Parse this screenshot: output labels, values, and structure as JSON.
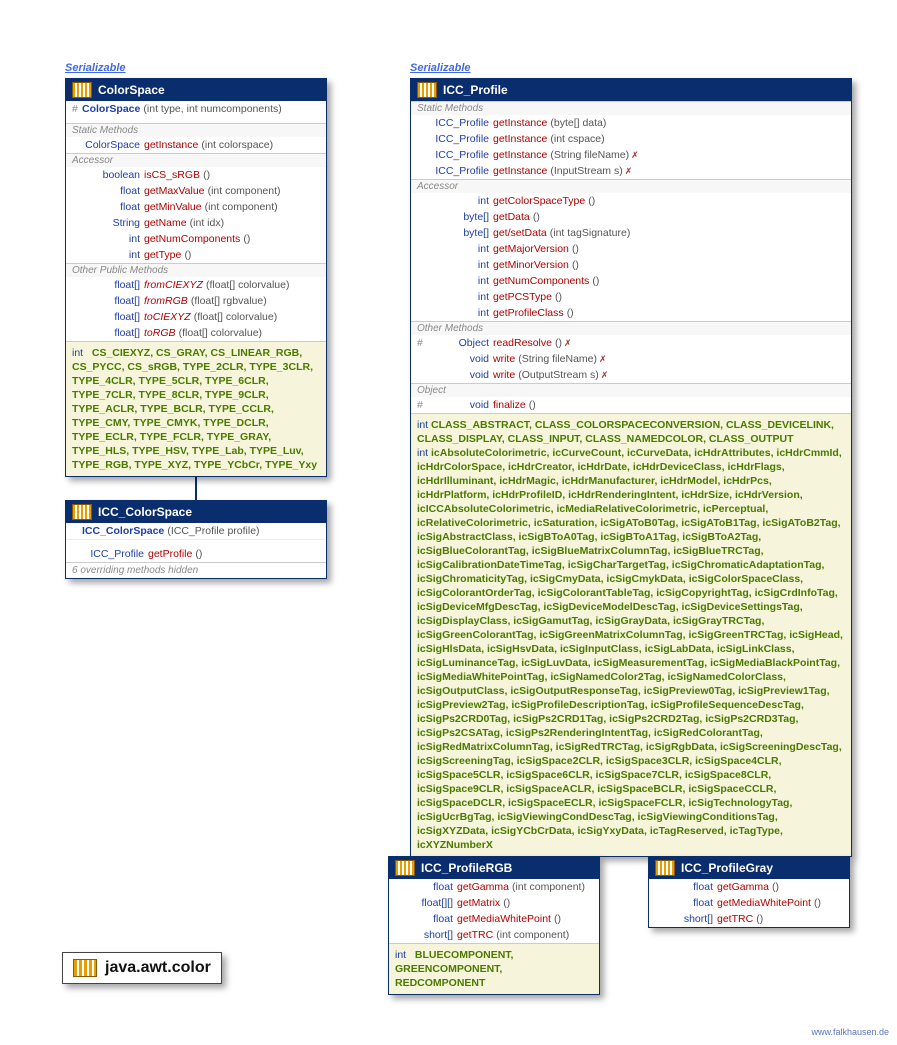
{
  "serializable": "Serializable",
  "package": "java.awt.color",
  "watermark": "www.falkhausen.de",
  "colorSpace": {
    "title": "ColorSpace",
    "ctor": {
      "hash": "#",
      "name": "ColorSpace",
      "params": "(int type, int numcomponents)"
    },
    "sections": {
      "static": "Static Methods",
      "accessor": "Accessor",
      "other": "Other Public Methods"
    },
    "staticMethods": [
      {
        "rt": "ColorSpace",
        "name": "getInstance",
        "params": "(int colorspace)"
      }
    ],
    "accessors": [
      {
        "rt": "boolean",
        "name": "isCS_sRGB",
        "params": "()"
      },
      {
        "rt": "float",
        "name": "getMaxValue",
        "params": "(int component)"
      },
      {
        "rt": "float",
        "name": "getMinValue",
        "params": "(int component)"
      },
      {
        "rt": "String",
        "name": "getName",
        "params": "(int idx)"
      },
      {
        "rt": "int",
        "name": "getNumComponents",
        "params": "()"
      },
      {
        "rt": "int",
        "name": "getType",
        "params": "()"
      }
    ],
    "otherMethods": [
      {
        "rt": "float[]",
        "name": "fromCIEXYZ",
        "params": "(float[] colorvalue)",
        "abs": true
      },
      {
        "rt": "float[]",
        "name": "fromRGB",
        "params": "(float[] rgbvalue)",
        "abs": true
      },
      {
        "rt": "float[]",
        "name": "toCIEXYZ",
        "params": "(float[] colorvalue)",
        "abs": true
      },
      {
        "rt": "float[]",
        "name": "toRGB",
        "params": "(float[] colorvalue)",
        "abs": true
      }
    ],
    "constType": "int",
    "consts": "CS_CIEXYZ, CS_GRAY, CS_LINEAR_RGB, CS_PYCC, CS_sRGB, TYPE_2CLR, TYPE_3CLR, TYPE_4CLR, TYPE_5CLR, TYPE_6CLR, TYPE_7CLR, TYPE_8CLR, TYPE_9CLR, TYPE_ACLR, TYPE_BCLR, TYPE_CCLR, TYPE_CMY, TYPE_CMYK, TYPE_DCLR, TYPE_ECLR, TYPE_FCLR, TYPE_GRAY, TYPE_HLS, TYPE_HSV, TYPE_Lab, TYPE_Luv, TYPE_RGB, TYPE_XYZ, TYPE_YCbCr, TYPE_Yxy"
  },
  "iccColorSpace": {
    "title": "ICC_ColorSpace",
    "ctor": {
      "name": "ICC_ColorSpace",
      "params": "(ICC_Profile profile)"
    },
    "methods": [
      {
        "rt": "ICC_Profile",
        "name": "getProfile",
        "params": "()"
      }
    ],
    "note": "6 overriding methods hidden"
  },
  "iccProfile": {
    "title": "ICC_Profile",
    "sections": {
      "static": "Static Methods",
      "accessor": "Accessor",
      "other": "Other Methods",
      "object": "Object"
    },
    "staticMethods": [
      {
        "rt": "ICC_Profile",
        "name": "getInstance",
        "params": "(byte[] data)"
      },
      {
        "rt": "ICC_Profile",
        "name": "getInstance",
        "params": "(int cspace)"
      },
      {
        "rt": "ICC_Profile",
        "name": "getInstance",
        "params": "(String fileName)",
        "throws": true
      },
      {
        "rt": "ICC_Profile",
        "name": "getInstance",
        "params": "(InputStream s)",
        "throws": true
      }
    ],
    "accessors": [
      {
        "rt": "int",
        "name": "getColorSpaceType",
        "params": "()"
      },
      {
        "rt": "byte[]",
        "name": "getData",
        "params": "()"
      },
      {
        "rt": "byte[]",
        "name": "get/setData",
        "params": "(int tagSignature)"
      },
      {
        "rt": "int",
        "name": "getMajorVersion",
        "params": "()"
      },
      {
        "rt": "int",
        "name": "getMinorVersion",
        "params": "()"
      },
      {
        "rt": "int",
        "name": "getNumComponents",
        "params": "()"
      },
      {
        "rt": "int",
        "name": "getPCSType",
        "params": "()"
      },
      {
        "rt": "int",
        "name": "getProfileClass",
        "params": "()"
      }
    ],
    "otherMethods": [
      {
        "hash": "#",
        "rt": "Object",
        "name": "readResolve",
        "params": "()",
        "throws": true
      },
      {
        "rt": "void",
        "name": "write",
        "params": "(String fileName)",
        "throws": true
      },
      {
        "rt": "void",
        "name": "write",
        "params": "(OutputStream s)",
        "throws": true
      }
    ],
    "objectMethods": [
      {
        "hash": "#",
        "rt": "void",
        "name": "finalize",
        "params": "()"
      }
    ],
    "constBlocks": [
      {
        "type": "int",
        "names": "CLASS_ABSTRACT, CLASS_COLORSPACECONVERSION, CLASS_DEVICELINK, CLASS_DISPLAY, CLASS_INPUT, CLASS_NAMEDCOLOR, CLASS_OUTPUT"
      },
      {
        "type": "int",
        "names": "icAbsoluteColorimetric, icCurveCount, icCurveData, icHdrAttributes, icHdrCmmId, icHdrColorSpace, icHdrCreator, icHdrDate, icHdrDeviceClass, icHdrFlags, icHdrIlluminant, icHdrMagic, icHdrManufacturer, icHdrModel, icHdrPcs, icHdrPlatform, icHdrProfileID, icHdrRenderingIntent, icHdrSize, icHdrVersion, icICCAbsoluteColorimetric, icMediaRelativeColorimetric, icPerceptual, icRelativeColorimetric, icSaturation, icSigAToB0Tag, icSigAToB1Tag, icSigAToB2Tag, icSigAbstractClass, icSigBToA0Tag, icSigBToA1Tag, icSigBToA2Tag, icSigBlueColorantTag, icSigBlueMatrixColumnTag, icSigBlueTRCTag, icSigCalibrationDateTimeTag, icSigCharTargetTag, icSigChromaticAdaptationTag, icSigChromaticityTag, icSigCmyData, icSigCmykData, icSigColorSpaceClass, icSigColorantOrderTag, icSigColorantTableTag, icSigCopyrightTag, icSigCrdInfoTag, icSigDeviceMfgDescTag, icSigDeviceModelDescTag, icSigDeviceSettingsTag, icSigDisplayClass, icSigGamutTag, icSigGrayData, icSigGrayTRCTag, icSigGreenColorantTag, icSigGreenMatrixColumnTag, icSigGreenTRCTag, icSigHead, icSigHlsData, icSigHsvData, icSigInputClass, icSigLabData, icSigLinkClass, icSigLuminanceTag, icSigLuvData, icSigMeasurementTag, icSigMediaBlackPointTag, icSigMediaWhitePointTag, icSigNamedColor2Tag, icSigNamedColorClass, icSigOutputClass, icSigOutputResponseTag, icSigPreview0Tag, icSigPreview1Tag, icSigPreview2Tag, icSigProfileDescriptionTag, icSigProfileSequenceDescTag, icSigPs2CRD0Tag, icSigPs2CRD1Tag, icSigPs2CRD2Tag, icSigPs2CRD3Tag, icSigPs2CSATag, icSigPs2RenderingIntentTag, icSigRedColorantTag, icSigRedMatrixColumnTag, icSigRedTRCTag, icSigRgbData, icSigScreeningDescTag, icSigScreeningTag, icSigSpace2CLR, icSigSpace3CLR, icSigSpace4CLR, icSigSpace5CLR, icSigSpace6CLR, icSigSpace7CLR, icSigSpace8CLR, icSigSpace9CLR, icSigSpaceACLR, icSigSpaceBCLR, icSigSpaceCCLR, icSigSpaceDCLR, icSigSpaceECLR, icSigSpaceFCLR, icSigTechnologyTag, icSigUcrBgTag, icSigViewingCondDescTag, icSigViewingConditionsTag, icSigXYZData, icSigYCbCrData, icSigYxyData, icTagReserved, icTagType, icXYZNumberX"
      }
    ]
  },
  "iccProfileRGB": {
    "title": "ICC_ProfileRGB",
    "methods": [
      {
        "rt": "float",
        "name": "getGamma",
        "params": "(int component)"
      },
      {
        "rt": "float[][]",
        "name": "getMatrix",
        "params": "()"
      },
      {
        "rt": "float",
        "name": "getMediaWhitePoint",
        "params": "()"
      },
      {
        "rt": "short[]",
        "name": "getTRC",
        "params": "(int component)"
      }
    ],
    "constType": "int",
    "consts": "BLUECOMPONENT, GREENCOMPONENT, REDCOMPONENT"
  },
  "iccProfileGray": {
    "title": "ICC_ProfileGray",
    "methods": [
      {
        "rt": "float",
        "name": "getGamma",
        "params": "()"
      },
      {
        "rt": "float",
        "name": "getMediaWhitePoint",
        "params": "()"
      },
      {
        "rt": "short[]",
        "name": "getTRC",
        "params": "()"
      }
    ]
  }
}
